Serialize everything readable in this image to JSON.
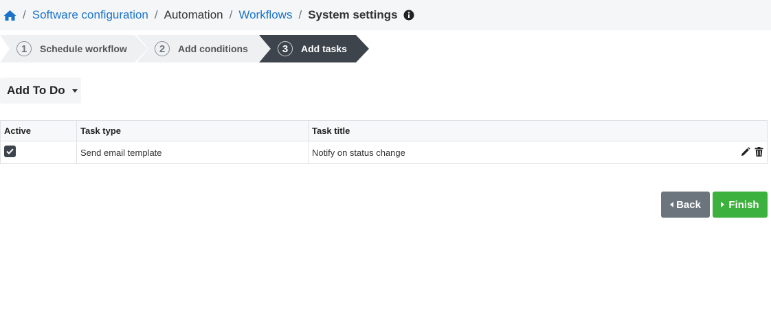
{
  "breadcrumb": {
    "home_icon": "home-icon",
    "separator": "/",
    "items": [
      {
        "label": "Software configuration",
        "type": "link"
      },
      {
        "label": "Automation",
        "type": "text"
      },
      {
        "label": "Workflows",
        "type": "link"
      },
      {
        "label": "System settings",
        "type": "current"
      }
    ],
    "info_icon": "info-circle-icon"
  },
  "wizard": {
    "steps": [
      {
        "number": "1",
        "label": "Schedule workflow",
        "state": "done"
      },
      {
        "number": "2",
        "label": "Add conditions",
        "state": "done"
      },
      {
        "number": "3",
        "label": "Add tasks",
        "state": "active"
      }
    ]
  },
  "add_todo": {
    "label": "Add To Do"
  },
  "table": {
    "headers": [
      "Active",
      "Task type",
      "Task title"
    ],
    "rows": [
      {
        "active": true,
        "task_type": "Send email template",
        "task_title": "Notify on status change"
      }
    ],
    "row_action_icons": [
      "pencil-icon",
      "trash-icon"
    ]
  },
  "footer": {
    "back_label": "Back",
    "finish_label": "Finish"
  },
  "colors": {
    "link": "#1a73c8",
    "active_step": "#3d444c",
    "inactive_step": "#eef0f2",
    "back_button": "#6c757d",
    "finish_button": "#3db13d"
  }
}
